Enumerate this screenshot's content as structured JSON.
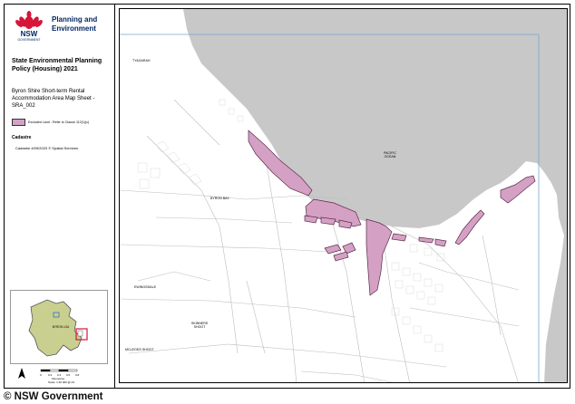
{
  "header": {
    "agency": "Planning and Environment",
    "logo_text": "NSW",
    "logo_subtext": "GOVERNMENT",
    "logo_icon": "waratah-icon"
  },
  "title": "State Environmental Planning Policy (Housing) 2021",
  "subtitle": "Byron Shire Short-term Rental Accommodation Area Map Sheet - SRA_002",
  "legend": {
    "items": [
      {
        "label": "Excluded Land - Refer to Clause 112(1)(c)",
        "color": "#d4a1c4"
      }
    ],
    "cadastre_heading": "Cadastre",
    "cadastre_credit": "Cadastre 4/09/2023 © Spatial Services"
  },
  "inset": {
    "region_label": "BYRON LGA"
  },
  "scale": {
    "ticks": [
      "0",
      "0.2",
      "0.4",
      "0.6",
      "0.8"
    ],
    "unit": "Kilometres",
    "ratio": "Scale: 1:20 000 @ A3"
  },
  "map": {
    "places": {
      "tyagarah": "TYAGARAH",
      "byron_bay": "BYRON BAY",
      "pacific_ocean": "PACIFIC OCEAN",
      "ewingsdale": "EWINGSDALE",
      "skinners_shoot": "SKINNERS SHOOT",
      "mcleods_shoot": "MCLEODS SHOOT"
    },
    "colors": {
      "ocean": "#c8c8c8",
      "land": "#ffffff",
      "excluded": "#d4a1c4",
      "roads": "#bdbdbd",
      "frame": "#7aa3d1"
    }
  },
  "watermark": "© NSW Government"
}
